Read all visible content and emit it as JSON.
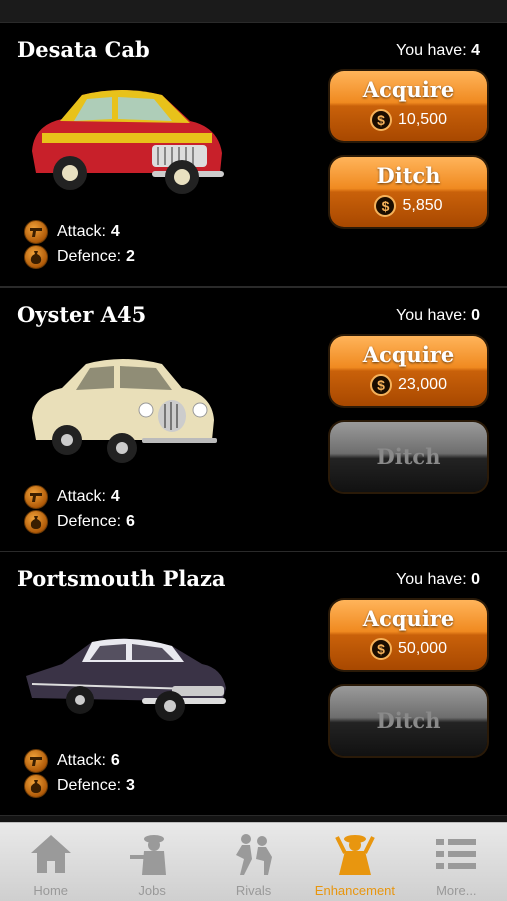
{
  "have_label": "You have:",
  "stats_labels": {
    "attack": "Attack:",
    "defence": "Defence:"
  },
  "currency_symbol": "$",
  "cars": [
    {
      "name": "Desata Cab",
      "have": "4",
      "attack": "4",
      "defence": "2",
      "acquire_label": "Acquire",
      "acquire_price": "10,500",
      "ditch_label": "Ditch",
      "ditch_price": "5,850",
      "ditch_enabled": true,
      "colors": {
        "body": "#c8202a",
        "top": "#e8c21a"
      }
    },
    {
      "name": "Oyster A45",
      "have": "0",
      "attack": "4",
      "defence": "6",
      "acquire_label": "Acquire",
      "acquire_price": "23,000",
      "ditch_label": "Ditch",
      "ditch_price": "",
      "ditch_enabled": false,
      "colors": {
        "body": "#e9dfb9",
        "top": "#e9dfb9"
      }
    },
    {
      "name": "Portsmouth Plaza",
      "have": "0",
      "attack": "6",
      "defence": "3",
      "acquire_label": "Acquire",
      "acquire_price": "50,000",
      "ditch_label": "Ditch",
      "ditch_price": "",
      "ditch_enabled": false,
      "colors": {
        "body": "#3a3346",
        "top": "#e9e9ef"
      }
    }
  ],
  "tabs": [
    {
      "label": "Home",
      "icon": "home-icon",
      "active": false
    },
    {
      "label": "Jobs",
      "icon": "gangster-icon",
      "active": false
    },
    {
      "label": "Rivals",
      "icon": "fight-icon",
      "active": false
    },
    {
      "label": "Enhancement",
      "icon": "mobster-icon",
      "active": true
    },
    {
      "label": "More...",
      "icon": "list-icon",
      "active": false
    }
  ],
  "accent_color": "#e8960f"
}
